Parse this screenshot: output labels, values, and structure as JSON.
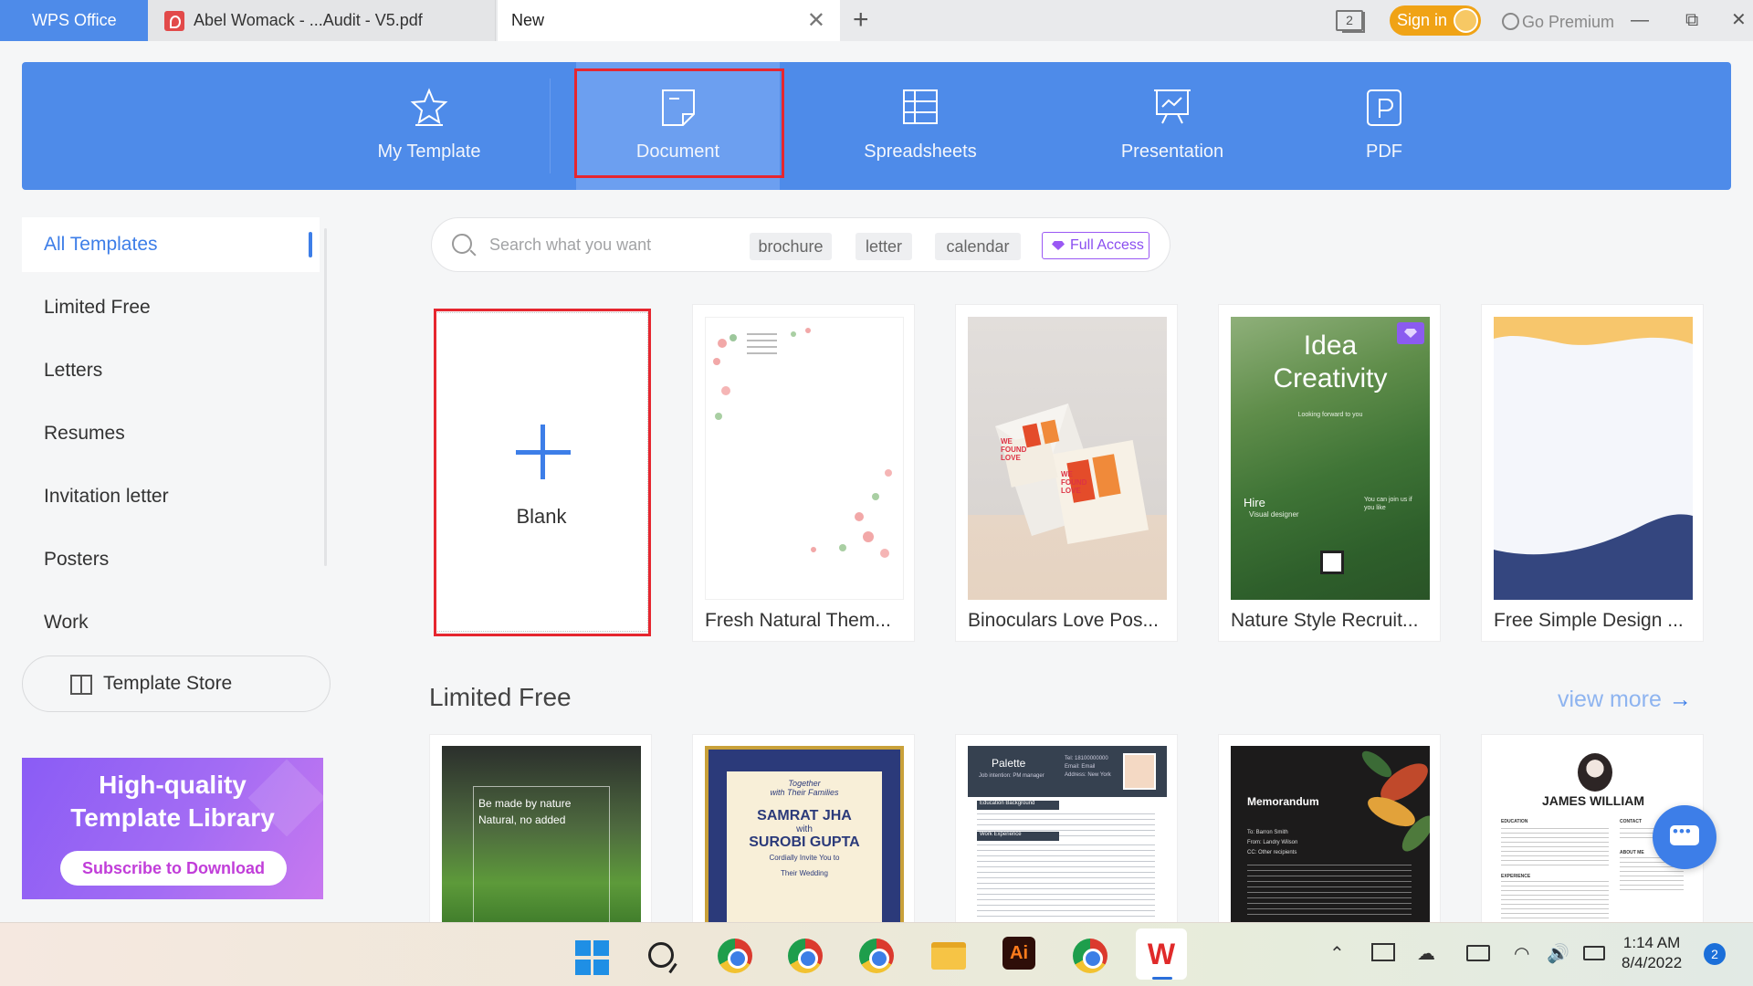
{
  "tabs": {
    "home": "WPS Office",
    "pdf": "Abel Womack - ...Audit - V5.pdf",
    "new": "New"
  },
  "titlebar": {
    "counter": "2",
    "signin": "Sign in",
    "premium": "Go Premium"
  },
  "categories": [
    {
      "label": "My Template",
      "icon": "star-icon"
    },
    {
      "label": "Document",
      "icon": "document-icon"
    },
    {
      "label": "Spreadsheets",
      "icon": "spreadsheet-icon"
    },
    {
      "label": "Presentation",
      "icon": "presentation-icon"
    },
    {
      "label": "PDF",
      "icon": "pdf-icon"
    }
  ],
  "sidebar": {
    "items": [
      "All Templates",
      "Limited Free",
      "Letters",
      "Resumes",
      "Invitation letter",
      "Posters",
      "Work"
    ],
    "store": "Template Store",
    "promo_line1": "High-quality",
    "promo_line2": "Template Library",
    "promo_button": "Subscribe to Download"
  },
  "search": {
    "placeholder": "Search what you want",
    "chips": [
      "brochure",
      "letter",
      "calendar"
    ],
    "full_access": "Full Access"
  },
  "blank_label": "Blank",
  "templates": [
    {
      "title": "Fresh Natural Them..."
    },
    {
      "title": "Binoculars Love Pos..."
    },
    {
      "title": "Nature Style Recruit...",
      "thumb_title1": "Idea",
      "thumb_title2": "Creativity",
      "thumb_sub": "Looking forward to you",
      "thumb_hire": "Hire",
      "thumb_role": "Visual designer",
      "thumb_right": "You can join us if you like"
    },
    {
      "title": "Free Simple Design ..."
    }
  ],
  "love_text": "WE FOUND LOVE",
  "limited_section": {
    "title": "Limited Free",
    "view_more": "view more",
    "cards": [
      {
        "line1": "Be made by nature",
        "line2": "Natural, no added"
      },
      {
        "line1": "Together",
        "line2": "with Their Families",
        "name1": "SAMRAT JHA",
        "with": "with",
        "name2": "SUROBI GUPTA",
        "line3": "Cordially Invite You to",
        "line4": "Their Wedding"
      },
      {
        "heading": "Palette",
        "sub": "Job intention: PM manager",
        "sec1": "Education Background",
        "sec2": "Work Experience",
        "tel": "Tel: 18100000000",
        "email": "Email: Email",
        "addr": "Address: New York"
      },
      {
        "heading": "Memorandum",
        "to": "To: Barron Smith",
        "from": "From: Landry Wilson",
        "cc": "CC: Other recipients"
      },
      {
        "name": "JAMES WILLIAM",
        "sec1": "EDUCATION",
        "sec2": "CONTACT",
        "sec3": "ABOUT ME",
        "sec4": "EXPERIENCE"
      }
    ]
  },
  "taskbar": {
    "time": "1:14 AM",
    "date": "8/4/2022",
    "notifications": "2",
    "ai_label": "Ai",
    "wps_label": "W"
  },
  "colors": {
    "accent": "#4e8be9",
    "highlight": "#e6262f",
    "premium": "#9a58f4",
    "signin": "#f0a316"
  }
}
